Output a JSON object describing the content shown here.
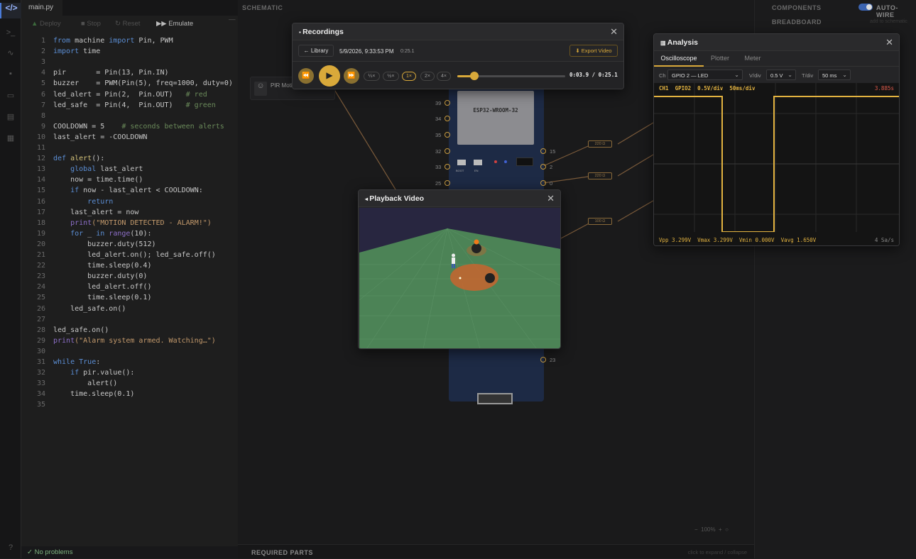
{
  "editor": {
    "tab": "main.py",
    "toolbar": {
      "deploy": "Deploy",
      "stop": "Stop",
      "reset": "Reset",
      "emulate": "Emulate"
    },
    "lines": [
      [
        [
          "kw",
          "from"
        ],
        [
          "t",
          " machine "
        ],
        [
          "kw",
          "import"
        ],
        [
          "t",
          " Pin, PWM"
        ]
      ],
      [
        [
          "kw",
          "import"
        ],
        [
          "t",
          " time"
        ]
      ],
      [],
      [
        [
          "t",
          "pir       = Pin(13, Pin.IN)"
        ]
      ],
      [
        [
          "t",
          "buzzer    = PWM(Pin(5), freq=1000, duty=0)"
        ]
      ],
      [
        [
          "t",
          "led_alert = Pin(2,  Pin.OUT)   "
        ],
        [
          "cm",
          "# red"
        ]
      ],
      [
        [
          "t",
          "led_safe  = Pin(4,  Pin.OUT)   "
        ],
        [
          "cm",
          "# green"
        ]
      ],
      [],
      [
        [
          "t",
          "COOLDOWN = 5    "
        ],
        [
          "cm",
          "# seconds between alerts"
        ]
      ],
      [
        [
          "t",
          "last_alert = -COOLDOWN"
        ]
      ],
      [],
      [
        [
          "kw",
          "def"
        ],
        [
          "t",
          " "
        ],
        [
          "fn",
          "alert"
        ],
        [
          "t",
          "():"
        ]
      ],
      [
        [
          "t",
          "    "
        ],
        [
          "kw",
          "global"
        ],
        [
          "t",
          " last_alert"
        ]
      ],
      [
        [
          "t",
          "    now = time.time()"
        ]
      ],
      [
        [
          "t",
          "    "
        ],
        [
          "kw",
          "if"
        ],
        [
          "t",
          " now - last_alert < COOLDOWN:"
        ]
      ],
      [
        [
          "t",
          "        "
        ],
        [
          "kw",
          "return"
        ]
      ],
      [
        [
          "t",
          "    last_alert = now"
        ]
      ],
      [
        [
          "t",
          "    "
        ],
        [
          "bi",
          "print"
        ],
        [
          "st",
          "(\"MOTION DETECTED - ALARM!\")"
        ]
      ],
      [
        [
          "t",
          "    "
        ],
        [
          "kw",
          "for"
        ],
        [
          "t",
          " _ "
        ],
        [
          "kw",
          "in"
        ],
        [
          "t",
          " "
        ],
        [
          "bi",
          "range"
        ],
        [
          "t",
          "(10):"
        ]
      ],
      [
        [
          "t",
          "        buzzer.duty(512)"
        ]
      ],
      [
        [
          "t",
          "        led_alert.on(); led_safe.off()"
        ]
      ],
      [
        [
          "t",
          "        time.sleep(0.4)"
        ]
      ],
      [
        [
          "t",
          "        buzzer.duty(0)"
        ]
      ],
      [
        [
          "t",
          "        led_alert.off()"
        ]
      ],
      [
        [
          "t",
          "        time.sleep(0.1)"
        ]
      ],
      [
        [
          "t",
          "    led_safe.on()"
        ]
      ],
      [],
      [
        [
          "t",
          "led_safe.on()"
        ]
      ],
      [
        [
          "bi",
          "print"
        ],
        [
          "st",
          "(\"Alarm system armed. Watching…\")"
        ]
      ],
      [],
      [
        [
          "kw",
          "while"
        ],
        [
          "t",
          " "
        ],
        [
          "kw",
          "True"
        ],
        [
          "t",
          ":"
        ]
      ],
      [
        [
          "t",
          "    "
        ],
        [
          "kw",
          "if"
        ],
        [
          "t",
          " pir.value():"
        ]
      ],
      [
        [
          "t",
          "        alert()"
        ]
      ],
      [
        [
          "t",
          "    time.sleep(0.1)"
        ]
      ],
      []
    ],
    "status": "✓ No problems"
  },
  "canvas": {
    "header": "SCHEMATIC",
    "pir_label": "PIR Moti",
    "board_label": "ESP32-WROOM-32",
    "left_pins": [
      "39",
      "34",
      "35",
      "32",
      "33",
      "25"
    ],
    "right_pins": [
      "15",
      "2",
      "0"
    ],
    "bottom_pin": "23",
    "resistor_label": "220 Ω",
    "resistor_label_3": "100 Ω",
    "board_buttons": [
      "BOOT",
      "EN"
    ],
    "zoom": "100%",
    "footer": "REQUIRED PARTS",
    "footer_hint": "click to expand / collapse"
  },
  "right_panel": {
    "components": "COMPONENTS",
    "auto_wire": "AUTO-WIRE",
    "breadboard": "BREADBOARD",
    "hint": "add to schematic"
  },
  "recordings": {
    "title": "Recordings",
    "library": "← Library",
    "datetime": "5/9/2026, 9:33:53 PM",
    "duration": "0:25.1",
    "export": "⬇ Export Video",
    "speeds": [
      "¼×",
      "½×",
      "1×",
      "2×",
      "4×"
    ],
    "active_speed": "1×",
    "time": "0:03.9 / 0:25.1",
    "progress": 0.155
  },
  "playback": {
    "title": "Playback Video"
  },
  "analysis": {
    "title": "Analysis",
    "tabs": [
      "Oscilloscope",
      "Plotter",
      "Meter"
    ],
    "active_tab": "Oscilloscope",
    "ch_label": "Ch",
    "ch_value": "GPIO 2 — LED",
    "vdiv_label": "V/div",
    "vdiv_value": "0.5 V",
    "tdiv_label": "T/div",
    "tdiv_value": "50 ms",
    "scope_info": "CH1  GPIO2  0.5V/div  50ms/div",
    "time_readout": "3.885s",
    "stats": "Vpp 3.299V  Vmax 3.299V  Vmin 0.000V  Vavg 1.650V",
    "rate": "4 Sa/s"
  },
  "colors": {
    "accent": "#d9a93a",
    "trace": "#e3b340",
    "readout": "#e05a4a"
  }
}
